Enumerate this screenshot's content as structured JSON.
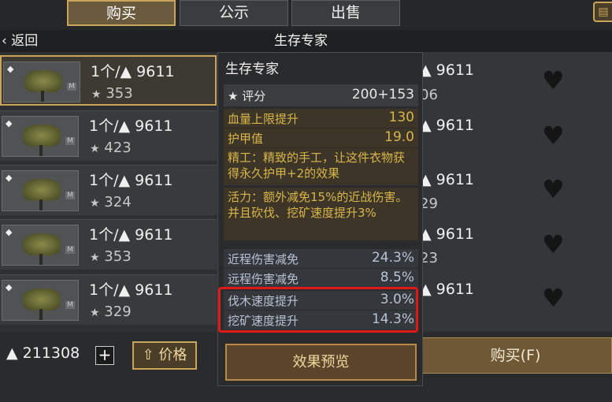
{
  "tabs": [
    {
      "label": "购买"
    },
    {
      "label": "公示"
    },
    {
      "label": "出售"
    }
  ],
  "header": {
    "back_label": "返回",
    "title": "生存专家"
  },
  "listings": [
    {
      "price": "1个/▲ 9611",
      "score": "353"
    },
    {
      "price": "1个/▲ 9611",
      "score": "423"
    },
    {
      "price": "1个/▲ 9611",
      "score": "324"
    },
    {
      "price": "1个/▲ 9611",
      "score": "353"
    },
    {
      "price": "1个/▲ 9611",
      "score": "329"
    }
  ],
  "right_column": {
    "prices": [
      "▲ 9611",
      "▲ 9611",
      "▲ 9611",
      "▲ 9611",
      "▲ 9611"
    ],
    "scores": [
      "06",
      "",
      "29",
      "23",
      ""
    ]
  },
  "popup": {
    "title": "生存专家",
    "rating_label": "评分",
    "rating_value": "200+153",
    "stats": [
      {
        "label": "血量上限提升",
        "value": "130"
      },
      {
        "label": "护甲值",
        "value": "19.0"
      }
    ],
    "perks": [
      "精工：精致的手工，让这件衣物获得永久护甲+2的效果",
      "活力：额外减免15%的近战伤害。并且砍伐、挖矿速度提升3%"
    ],
    "bonuses": [
      {
        "label": "近程伤害减免",
        "value": "24.3%"
      },
      {
        "label": "远程伤害减免",
        "value": "8.5%"
      },
      {
        "label": "伐木速度提升",
        "value": "3.0%"
      },
      {
        "label": "挖矿速度提升",
        "value": "14.3%"
      }
    ],
    "preview_button": "效果预览"
  },
  "footer": {
    "balance": "▲ 211308",
    "plus": "+",
    "price_sort_label": "价格",
    "buy_button": "购买(F)"
  },
  "colors": {
    "accent_gold": "#c9a55a",
    "perk_text": "#d9b54a",
    "highlight_red": "#e01818"
  },
  "icons": [
    "gem-icon",
    "currency-icon",
    "rating-icon",
    "heart-icon",
    "plus-icon",
    "arrow-up-icon",
    "back-chevron-icon",
    "notebook-icon"
  ]
}
